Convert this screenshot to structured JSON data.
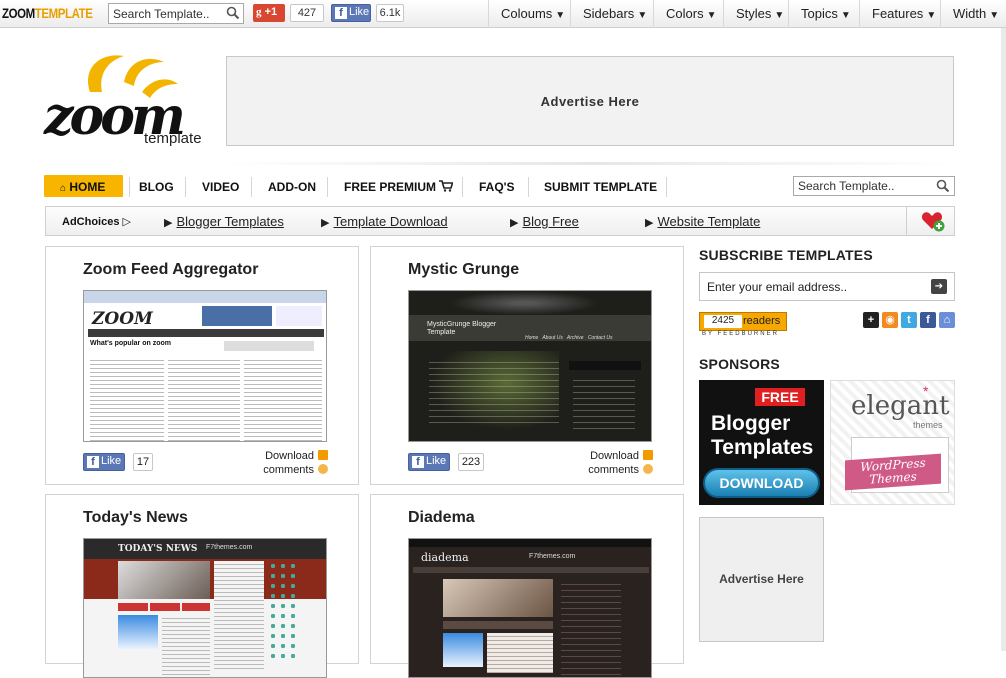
{
  "topbar": {
    "brand_a": "ZOOM",
    "brand_b": "TEMPLATE",
    "search_placeholder": "Search Template..",
    "gplus_label": "+1",
    "gplus_count": "427",
    "fb_like_label": "Like",
    "fb_count": "6.1k",
    "menus": [
      "Coloums",
      "Sidebars",
      "Colors",
      "Styles",
      "Topics",
      "Features",
      "Width"
    ]
  },
  "header": {
    "logo_word": "zoom",
    "logo_sub": "template",
    "advert": "Advertise Here"
  },
  "nav": {
    "items": [
      "HOME",
      "BLOG",
      "VIDEO",
      "ADD-ON",
      "FREE PREMIUM",
      "FAQ'S",
      "SUBMIT TEMPLATE"
    ],
    "search_placeholder": "Search Template.."
  },
  "subbar": {
    "adchoices": "AdChoices",
    "links": [
      "Blogger Templates",
      "Template Download",
      "Blog Free",
      "Website Template"
    ]
  },
  "cards": [
    {
      "title": "Zoom Feed Aggregator",
      "likes": "17",
      "download": "Download",
      "comments": "comments"
    },
    {
      "title": "Mystic Grunge",
      "likes": "223",
      "download": "Download",
      "comments": "comments"
    },
    {
      "title": "Today's News"
    },
    {
      "title": "Diadema"
    }
  ],
  "thumbs": {
    "zoom_heading": "What's popular on zoom",
    "mystic_title": "MysticGrunge Blogger Template",
    "mystic_nav": [
      "Home",
      "About Us",
      "Archive",
      "Contact Us"
    ],
    "todays_header": "TODAY'S NEWS",
    "todays_site": "F7themes.com",
    "diadema_name": "diadema",
    "diadema_site": "F7themes.com"
  },
  "sidebar": {
    "subscribe_heading": "SUBSCRIBE TEMPLATES",
    "email_placeholder": "Enter your email address..",
    "readers_count": "2425",
    "readers_label": "readers",
    "feedburner": "BY FEEDBURNER",
    "sponsors_heading": "SPONSORS",
    "sponsor1_free": "FREE",
    "sponsor1_line1": "Blogger",
    "sponsor1_line2": "Templates",
    "sponsor1_btn": "DOWNLOAD",
    "sponsor2_name": "elegant",
    "sponsor2_themes": "themes",
    "sponsor2_wp1": "WordPress",
    "sponsor2_wp2": "Themes",
    "advert": "Advertise Here"
  },
  "colors": {
    "accent": "#f7b500",
    "facebook": "#5b78b6",
    "gplus": "#d8472f"
  }
}
